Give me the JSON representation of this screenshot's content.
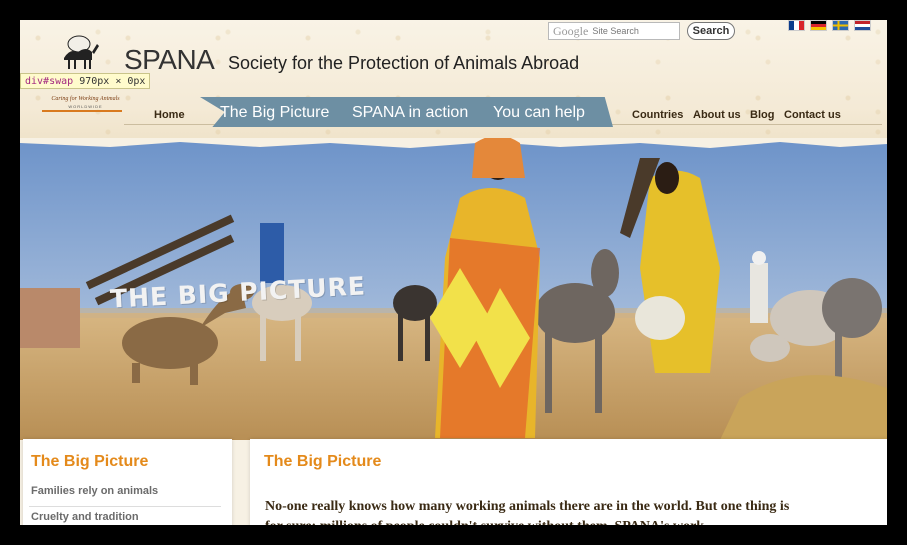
{
  "header": {
    "brand": "SPANA",
    "tagline": "Society for the Protection of Animals Abroad",
    "logo_sub": "Caring for Working Animals",
    "logo_sub2": "WORLDWIDE",
    "logo_icon": "camel-icon",
    "search": {
      "brand": "Google",
      "placeholder": "Site Search",
      "button": "Search"
    },
    "flags": [
      "flag-france-icon",
      "flag-germany-icon",
      "flag-sweden-icon",
      "flag-netherlands-icon"
    ]
  },
  "devtools": {
    "selector": "div#swap",
    "size": "970px × 0px"
  },
  "nav": {
    "home": "Home",
    "banner_items": [
      "The Big Picture",
      "SPANA in action",
      "You can help"
    ],
    "small_items": [
      "Countries",
      "About us",
      "Blog",
      "Contact us"
    ]
  },
  "hero": {
    "title": "THE BIG PICTURE"
  },
  "sidebar": {
    "title": "The Big Picture",
    "items": [
      "Families rely on animals",
      "Cruelty and tradition"
    ]
  },
  "main": {
    "title": "The Big Picture",
    "paragraph": "No-one really knows how many working animals there are in the world. But one thing is for sure: millions of people couldn't survive without them. SPANA's work"
  },
  "colors": {
    "accent": "#e48a1b",
    "nav_banner": "#6d8fa3",
    "text_dark": "#3a2a14"
  }
}
